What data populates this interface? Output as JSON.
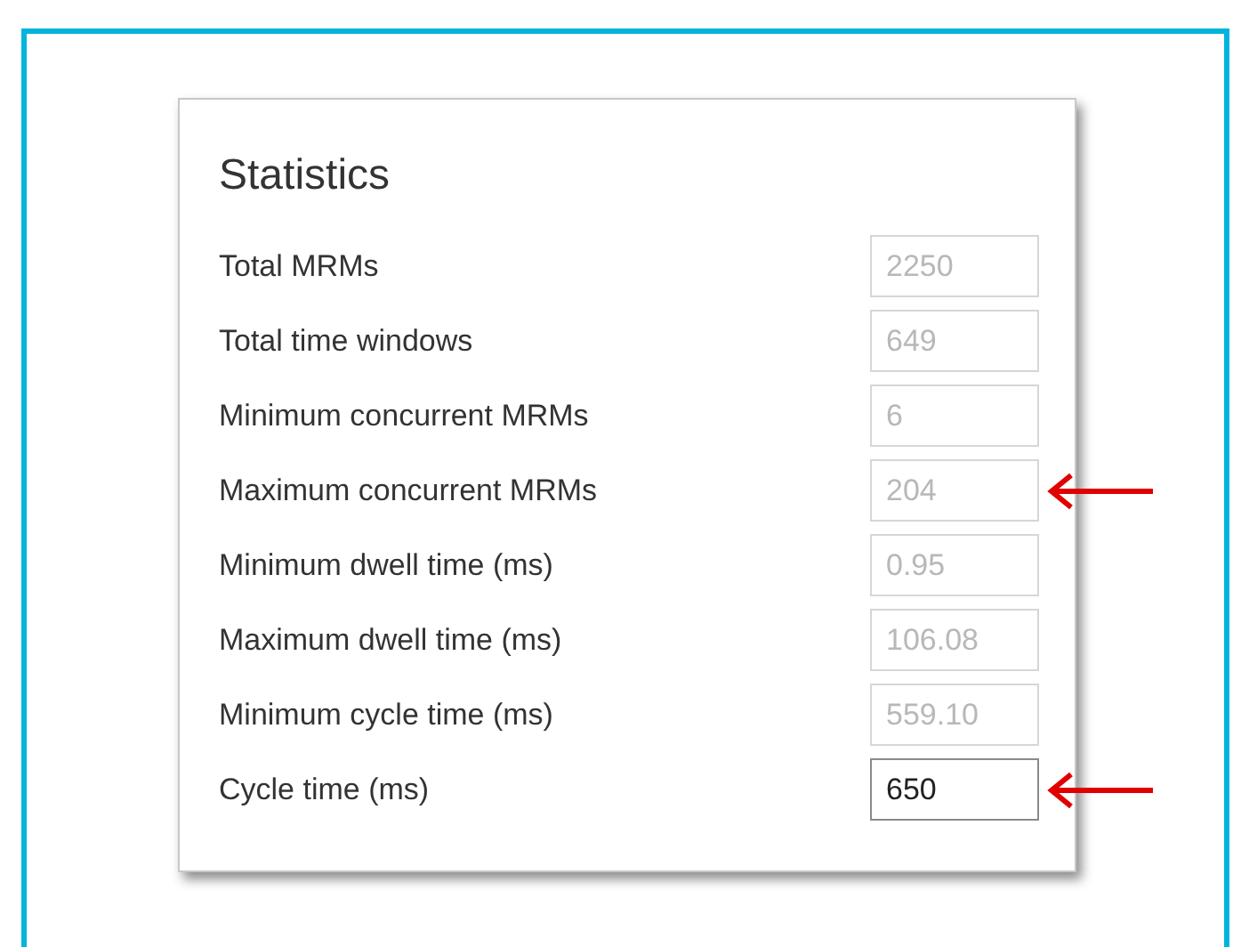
{
  "panel": {
    "title": "Statistics",
    "rows": [
      {
        "label": "Total MRMs",
        "value": "2250",
        "disabled": true,
        "annotated": false
      },
      {
        "label": "Total time windows",
        "value": "649",
        "disabled": true,
        "annotated": false
      },
      {
        "label": "Minimum concurrent MRMs",
        "value": "6",
        "disabled": true,
        "annotated": false
      },
      {
        "label": "Maximum concurrent MRMs",
        "value": "204",
        "disabled": true,
        "annotated": true
      },
      {
        "label": "Minimum dwell time (ms)",
        "value": "0.95",
        "disabled": true,
        "annotated": false
      },
      {
        "label": "Maximum dwell time (ms)",
        "value": "106.08",
        "disabled": true,
        "annotated": false
      },
      {
        "label": "Minimum cycle time (ms)",
        "value": "559.10",
        "disabled": true,
        "annotated": false
      },
      {
        "label": "Cycle time (ms)",
        "value": "650",
        "disabled": false,
        "annotated": true
      }
    ]
  }
}
